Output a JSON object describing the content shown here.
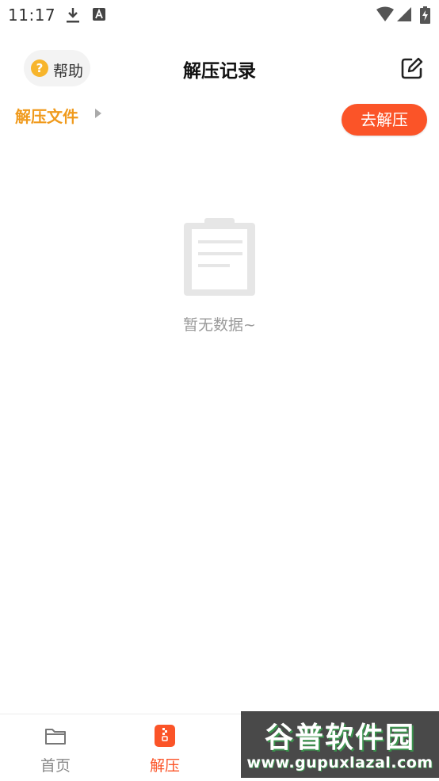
{
  "status_bar": {
    "time": "11:17",
    "icons": [
      "download-icon",
      "a-badge-icon",
      "wifi-icon",
      "signal-icon",
      "battery-icon"
    ]
  },
  "header": {
    "help_label": "帮助",
    "help_icon_glyph": "?",
    "title": "解压记录",
    "edit_icon": "edit-icon"
  },
  "sub_row": {
    "files_label": "解压文件",
    "go_button_label": "去解压"
  },
  "empty_state": {
    "icon": "clipboard-icon",
    "text": "暂无数据~"
  },
  "bottom_nav": {
    "items": [
      {
        "label": "首页",
        "icon": "folder-icon",
        "active": false
      },
      {
        "label": "解压",
        "icon": "zip-icon",
        "active": true
      }
    ]
  },
  "watermark": {
    "title": "谷普软件园",
    "url": "www.gupuxlazal.com"
  },
  "colors": {
    "accent_orange": "#fb5428",
    "label_orange": "#f09a1c",
    "help_yellow": "#f7b52c",
    "inactive_gray": "#8a8a8a"
  }
}
